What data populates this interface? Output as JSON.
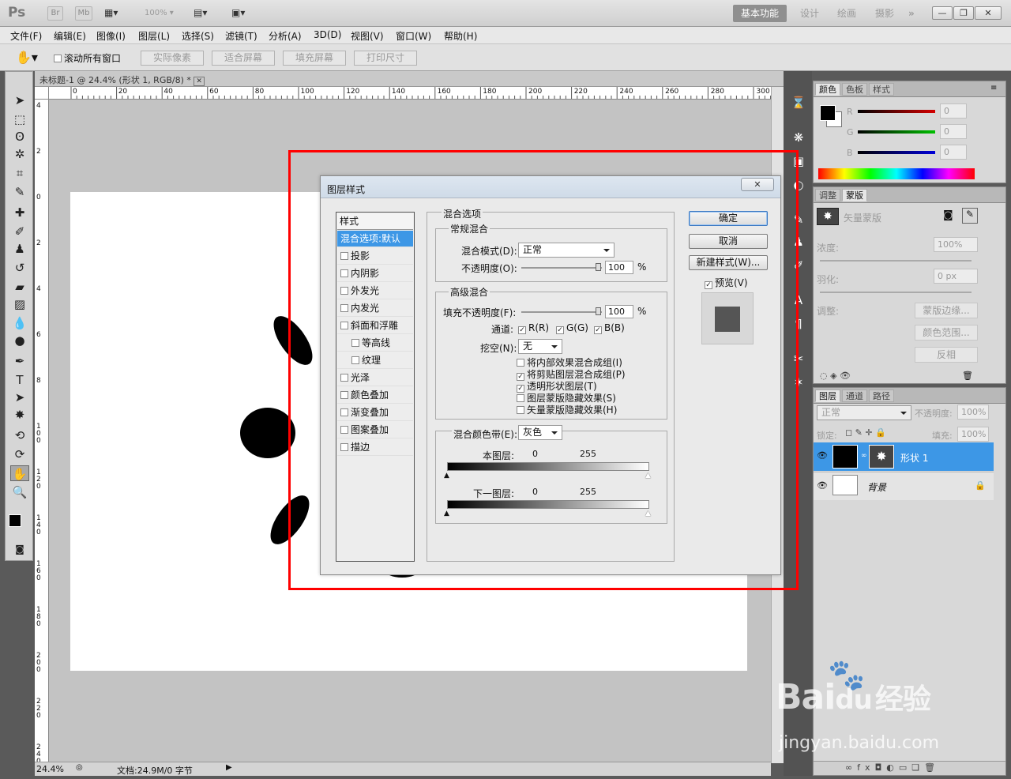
{
  "app": {
    "logo": "Ps",
    "title_buttons": [
      "Br",
      "Mb"
    ],
    "zoom_display": "100%",
    "workspaces": [
      "基本功能",
      "设计",
      "绘画",
      "摄影"
    ],
    "more_workspaces": "»",
    "window_controls": [
      "—",
      "❐",
      "✕"
    ]
  },
  "menu": [
    "文件(F)",
    "编辑(E)",
    "图像(I)",
    "图层(L)",
    "选择(S)",
    "滤镜(T)",
    "分析(A)",
    "3D(D)",
    "视图(V)",
    "窗口(W)",
    "帮助(H)"
  ],
  "options": {
    "scroll_all": "滚动所有窗口",
    "buttons": [
      "实际像素",
      "适合屏幕",
      "填充屏幕",
      "打印尺寸"
    ]
  },
  "document": {
    "tab": "未标题-1 @ 24.4% (形状 1, RGB/8) *",
    "ruler_top": [
      "0",
      "20",
      "40",
      "60",
      "80",
      "100",
      "120",
      "140",
      "160",
      "180",
      "200",
      "220",
      "240",
      "260",
      "280",
      "300"
    ],
    "ruler_left": [
      "4",
      "2",
      "0",
      "2",
      "4",
      "6",
      "8",
      "1\n0\n0",
      "1\n2\n0",
      "1\n4\n0",
      "1\n6\n0",
      "1\n8\n0",
      "2\n0\n0",
      "2\n2\n0",
      "2\n4\n0"
    ],
    "zoom": "24.4%",
    "doc_info": "文档:24.9M/0 字节"
  },
  "panels": {
    "color": {
      "tabs": [
        "颜色",
        "色板",
        "样式"
      ],
      "channels": [
        {
          "name": "R",
          "value": "0",
          "color": "#d40000"
        },
        {
          "name": "G",
          "value": "0",
          "color": "#00c000"
        },
        {
          "name": "B",
          "value": "0",
          "color": "#0000d8"
        }
      ]
    },
    "adjust": {
      "tabs": [
        "调整",
        "蒙版"
      ],
      "vector_mask": "矢量蒙版",
      "density_label": "浓度:",
      "density": "100%",
      "feather_label": "羽化:",
      "feather": "0 px",
      "refine_label": "调整:",
      "buttons": [
        "蒙版边缘...",
        "颜色范围...",
        "反相"
      ]
    },
    "layers": {
      "tabs": [
        "图层",
        "通道",
        "路径"
      ],
      "blend": "正常",
      "opacity_label": "不透明度:",
      "opacity": "100%",
      "lock_label": "锁定:",
      "fill_label": "填充:",
      "fill": "100%",
      "items": [
        {
          "name": "形状 1",
          "selected": true
        },
        {
          "name": "背景",
          "selected": false
        }
      ],
      "footer_icons": [
        "∞",
        "fx",
        "◘",
        "◐",
        "▭",
        "❏",
        "🗑"
      ]
    }
  },
  "dialog": {
    "title": "图层样式",
    "close": "✕",
    "styles_header": "样式",
    "styles": [
      {
        "label": "混合选项:默认",
        "selected": true,
        "checkbox": false,
        "indent": false
      },
      {
        "label": "投影",
        "checkbox": true,
        "indent": false
      },
      {
        "label": "内阴影",
        "checkbox": true,
        "indent": false
      },
      {
        "label": "外发光",
        "checkbox": true,
        "indent": false
      },
      {
        "label": "内发光",
        "checkbox": true,
        "indent": false
      },
      {
        "label": "斜面和浮雕",
        "checkbox": true,
        "indent": false
      },
      {
        "label": "等高线",
        "checkbox": true,
        "indent": true
      },
      {
        "label": "纹理",
        "checkbox": true,
        "indent": true
      },
      {
        "label": "光泽",
        "checkbox": true,
        "indent": false
      },
      {
        "label": "颜色叠加",
        "checkbox": true,
        "indent": false
      },
      {
        "label": "渐变叠加",
        "checkbox": true,
        "indent": false
      },
      {
        "label": "图案叠加",
        "checkbox": true,
        "indent": false
      },
      {
        "label": "描边",
        "checkbox": true,
        "indent": false
      }
    ],
    "blend_options": "混合选项",
    "general": "常规混合",
    "blend_mode_label": "混合模式(D):",
    "blend_mode": "正常",
    "opacity_label": "不透明度(O):",
    "opacity": "100",
    "percent": "%",
    "advanced": "高级混合",
    "fill_opacity_label": "填充不透明度(F):",
    "fill_opacity": "100",
    "channels_label": "通道:",
    "channels": [
      "R(R)",
      "G(G)",
      "B(B)"
    ],
    "knockout_label": "挖空(N):",
    "knockout": "无",
    "options": [
      {
        "label": "将内部效果混合成组(I)",
        "checked": false
      },
      {
        "label": "将剪贴图层混合成组(P)",
        "checked": true
      },
      {
        "label": "透明形状图层(T)",
        "checked": true
      },
      {
        "label": "图层蒙版隐藏效果(S)",
        "checked": false
      },
      {
        "label": "矢量蒙版隐藏效果(H)",
        "checked": false
      }
    ],
    "blend_if_label": "混合颜色带(E):",
    "blend_if": "灰色",
    "this_layer": "本图层:",
    "underlying": "下一图层:",
    "range_min": "0",
    "range_max": "255",
    "ok": "确定",
    "cancel": "取消",
    "new_style": "新建样式(W)...",
    "preview": "预览(V)"
  },
  "watermark": {
    "brand": "Bai",
    "brand2": "du",
    "cn": "经验",
    "url": "jingyan.baidu.com"
  },
  "colors": {
    "highlight": "#ff0000",
    "selection": "#3d97e6"
  }
}
